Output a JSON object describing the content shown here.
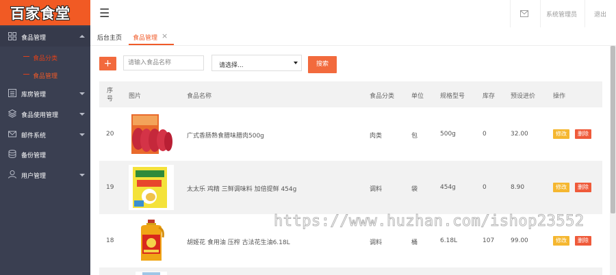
{
  "app": {
    "logo": "百家食堂"
  },
  "sidebar": {
    "items": [
      {
        "label": "食品管理",
        "icon": "grid-icon",
        "expanded": true,
        "children": [
          {
            "label": "食品分类"
          },
          {
            "label": "食品管理"
          }
        ]
      },
      {
        "label": "库房管理",
        "icon": "list-icon"
      },
      {
        "label": "食品使用管理",
        "icon": "layers-icon"
      },
      {
        "label": "邮件系统",
        "icon": "mail-icon"
      },
      {
        "label": "备份管理",
        "icon": "database-icon"
      },
      {
        "label": "用户管理",
        "icon": "user-icon"
      }
    ]
  },
  "topbar": {
    "menu_icon": "hamburger-icon",
    "mail_icon": "mail-icon",
    "user": "系统管理员",
    "logout": "退出"
  },
  "tabs": [
    {
      "label": "后台主页"
    },
    {
      "label": "食品管理",
      "close": "×"
    }
  ],
  "toolbar": {
    "add": "+",
    "search_placeholder": "请输入食品名称",
    "select_value": "请选择...",
    "search_button": "搜索"
  },
  "table": {
    "headers": {
      "id": "序号",
      "image": "图片",
      "name": "食品名称",
      "category": "食品分类",
      "unit": "单位",
      "spec": "规格型号",
      "stock": "库存",
      "price": "预设进价",
      "actions": "操作"
    },
    "rows": [
      {
        "id": "20",
        "name": "广式香肠熟食腊味腊肉500g",
        "category": "肉类",
        "unit": "包",
        "spec": "500g",
        "stock": "0",
        "price": "32.00",
        "edit": "修改",
        "delete": "删除"
      },
      {
        "id": "19",
        "name": "太太乐 鸡精 三鲜调味料 加倍提鲜 454g",
        "category": "调料",
        "unit": "袋",
        "spec": "454g",
        "stock": "0",
        "price": "8.90",
        "edit": "修改",
        "delete": "删除"
      },
      {
        "id": "18",
        "name": "胡姬花 食用油 压榨 古法花生油6.18L",
        "category": "调料",
        "unit": "桶",
        "spec": "6.18L",
        "stock": "107",
        "price": "99.00",
        "edit": "修改",
        "delete": "删除"
      }
    ]
  },
  "watermark": "https://www.huzhan.com/ishop23552",
  "colors": {
    "accent": "#f05a28",
    "sidebar": "#3a3f51",
    "edit": "#f5b730",
    "delete": "#ef5a3a"
  }
}
